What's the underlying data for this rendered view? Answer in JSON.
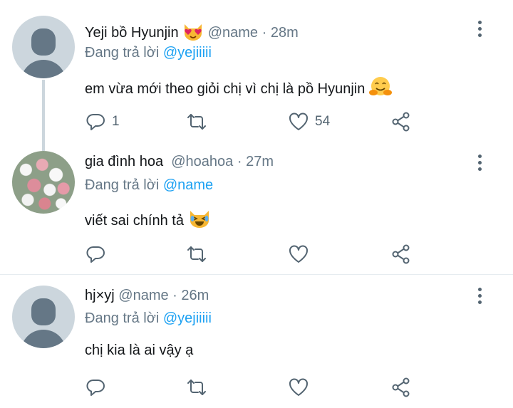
{
  "tweets": [
    {
      "name": "Yeji bồ Hyunjin",
      "name_emoji": "heart-eyes-cat-emoji",
      "handle": "@name",
      "dot": "·",
      "time": "28m",
      "reply_prefix": "Đang trả lời",
      "reply_to": "@yejiiiii",
      "text": "em vừa mới theo giỏi chị vì chị là pồ Hyunjin",
      "text_emoji": "hugging-face-emoji",
      "reply_count": "1",
      "retweet_count": "",
      "like_count": "54"
    },
    {
      "name": "gia đình hoa",
      "handle": "@hoahoa",
      "dot": "·",
      "time": "27m",
      "reply_prefix": "Đang trả lời",
      "reply_to": "@name",
      "text": "viết sai chính tả",
      "text_emoji": "laughing-cat-emoji",
      "reply_count": "",
      "retweet_count": "",
      "like_count": ""
    },
    {
      "name": "hj×yj",
      "handle": "@name",
      "dot": "·",
      "time": "26m",
      "reply_prefix": "Đang trả lời",
      "reply_to": "@yejiiiii",
      "text": "chị kia là ai vậy ạ",
      "reply_count": "",
      "retweet_count": "",
      "like_count": ""
    }
  ],
  "colors": {
    "mention": "#1da1f2",
    "secondary_text": "#657786",
    "icon": "#536471",
    "divider": "#e6ecf0"
  }
}
